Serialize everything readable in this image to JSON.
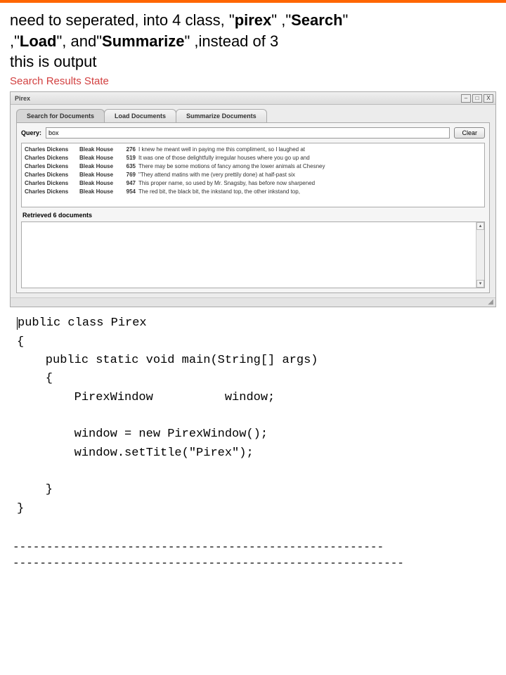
{
  "question": {
    "line1_pre": "need to seperated, into 4 class, \"",
    "b1": "pirex",
    "mid1": "\" ,\"",
    "b2": "Search",
    "line1_post": "\"",
    "line2_pre": ",\"",
    "b3": "Load",
    "mid2": "\", and\"",
    "b4": "Summarize",
    "line2_post": "\" ,instead of 3",
    "subtext": "this is output",
    "red_heading": "Search Results State"
  },
  "window": {
    "title": "Pirex",
    "buttons": {
      "min": "–",
      "max": "□",
      "close": "X"
    }
  },
  "tabs": {
    "t0": "Search for Documents",
    "t1": "Load Documents",
    "t2": "Summarize Documents"
  },
  "query": {
    "label": "Query:",
    "value": "box",
    "clear": "Clear"
  },
  "results": [
    {
      "author": "Charles Dickens",
      "title": "Bleak House",
      "num": "276",
      "snippet": "I knew he meant well in paying me this compliment, so I laughed at"
    },
    {
      "author": "Charles Dickens",
      "title": "Bleak House",
      "num": "519",
      "snippet": "It was one of those delightfully irregular houses where you go up and"
    },
    {
      "author": "Charles Dickens",
      "title": "Bleak House",
      "num": "635",
      "snippet": "There may be some motions of fancy among the lower animals at Chesney"
    },
    {
      "author": "Charles Dickens",
      "title": "Bleak House",
      "num": "769",
      "snippet": "\"They attend matins with me (very prettily done) at half-past six"
    },
    {
      "author": "Charles Dickens",
      "title": "Bleak House",
      "num": "947",
      "snippet": "This proper name, so used by Mr. Snagsby, has before now sharpened"
    },
    {
      "author": "Charles Dickens",
      "title": "Bleak House",
      "num": "954",
      "snippet": "The red bit, the black bit, the inkstand top, the other inkstand top,"
    }
  ],
  "retrieved": "Retrieved 6 documents",
  "code": {
    "l1a": "public class Pirex",
    "l2": "{",
    "l3": "    public static void main(String[] args)",
    "l4": "    {",
    "l5": "        PirexWindow          window;",
    "l6": "",
    "l7": "        window = new PirexWindow();",
    "l8": "        window.setTitle(\"Pirex\");",
    "l9": "",
    "l10": "    }",
    "l11": "}"
  },
  "dashes": {
    "d1": "-------------------------------------------------------",
    "d2": "----------------------------------------------------------"
  }
}
